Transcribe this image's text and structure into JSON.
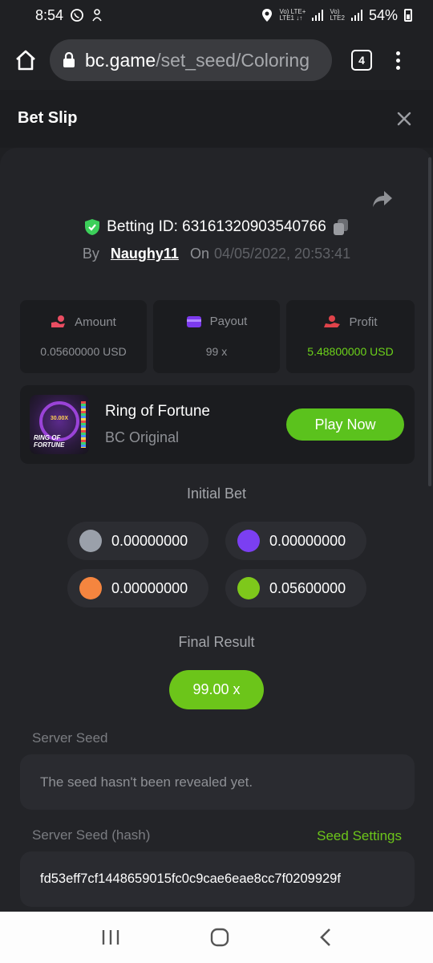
{
  "status_bar": {
    "time": "8:54",
    "network_line1": "Vo) LTE+",
    "network_line2": "LTE1 ↓↑",
    "network2_line1": "Vo)",
    "network2_line2": "LTE2",
    "battery": "54%"
  },
  "browser": {
    "url_host": "bc.game",
    "url_path": "/set_seed/Coloring",
    "tab_count": "4"
  },
  "header": {
    "title": "Bet Slip"
  },
  "bet": {
    "id_label": "Betting ID: 63161320903540766",
    "by_label": "By",
    "user": "Naughy11",
    "on_label": "On",
    "date": "04/05/2022, 20:53:41"
  },
  "stats": [
    {
      "label": "Amount",
      "value": "0.05600000 USD",
      "icon": "money-hand-icon",
      "icon_color": "#ea4d62"
    },
    {
      "label": "Payout",
      "value": "99 x",
      "icon": "wallet-icon",
      "icon_color": "#7c3aed"
    },
    {
      "label": "Profit",
      "value": "5.48800000 USD",
      "icon": "profit-hand-icon",
      "icon_color": "#e0434a"
    }
  ],
  "game": {
    "thumb_multiplier": "30.00X",
    "thumb_title_line1": "RING OF",
    "thumb_title_line2": "FORTUNE",
    "name": "Ring of Fortune",
    "provider": "BC Original",
    "play_label": "Play Now"
  },
  "initial_bet": {
    "title": "Initial Bet",
    "chips": [
      {
        "color": "#9aa0aa",
        "value": "0.00000000"
      },
      {
        "color": "#7b3ff2",
        "value": "0.00000000"
      },
      {
        "color": "#f5853f",
        "value": "0.00000000"
      },
      {
        "color": "#7ec81b",
        "value": "0.05600000"
      }
    ]
  },
  "final_result": {
    "title": "Final Result",
    "value": "99.00 x"
  },
  "server_seed": {
    "label": "Server Seed",
    "value": "The seed hasn't been revealed yet."
  },
  "server_seed_hash": {
    "label": "Server Seed (hash)",
    "settings_link": "Seed Settings",
    "value": "fd53eff7cf1448659015fc0c9cae6eae8cc7f0209929f"
  },
  "colors": {
    "accent_green": "#6cc51a",
    "background": "#1f2023",
    "card": "#232428"
  }
}
